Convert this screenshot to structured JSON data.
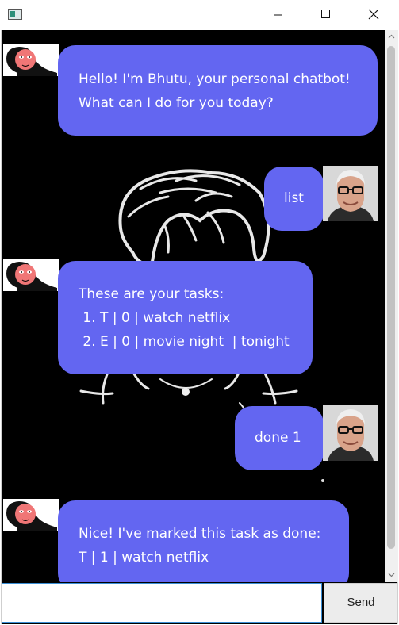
{
  "window": {
    "title": "",
    "icon": "app-icon",
    "controls": [
      "minimize-icon",
      "maximize-icon",
      "close-icon"
    ]
  },
  "messages": [
    {
      "sender": "Bhutu",
      "avatar": "bot-avatar",
      "lines": [
        "Hello! I'm Bhutu, your personal chatbot!",
        "What can I do for you today?"
      ]
    },
    {
      "sender": "user",
      "avatar": "user-avatar",
      "lines": [
        "list"
      ]
    },
    {
      "sender": "Bhutu",
      "avatar": "bot-avatar",
      "lines": [
        "These are your tasks:",
        " 1. T | 0 | watch netflix",
        " 2. E | 0 | movie night  | tonight"
      ]
    },
    {
      "sender": "user",
      "avatar": "user-avatar",
      "lines": [
        "done 1"
      ]
    },
    {
      "sender": "Bhutu",
      "avatar": "bot-avatar",
      "lines": [
        "Nice! I've marked this task as done:",
        "T | 1 | watch netflix"
      ]
    }
  ],
  "input": {
    "value": "",
    "placeholder": ""
  },
  "send_button": {
    "label": "Send"
  },
  "colors": {
    "bubble": "#6366f1",
    "background": "#000000",
    "input_border": "#3b8fd6"
  }
}
